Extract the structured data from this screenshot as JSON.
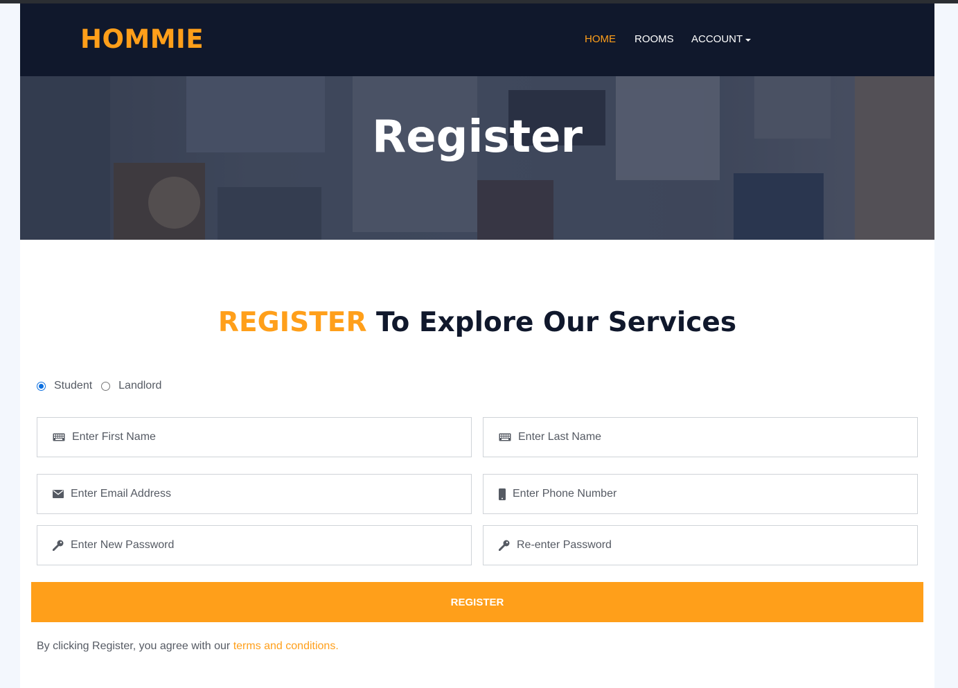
{
  "brand": {
    "name": "HOMMIE",
    "color": "#ff9f1a"
  },
  "nav": {
    "items": [
      {
        "label": "HOME",
        "active": true
      },
      {
        "label": "ROOMS",
        "active": false
      },
      {
        "label": "ACCOUNT",
        "active": false,
        "dropdown": true
      }
    ]
  },
  "hero": {
    "title": "Register"
  },
  "section": {
    "heading_highlight": "REGISTER",
    "heading_rest": " To Explore Our Services"
  },
  "user_type": {
    "options": [
      {
        "label": "Student",
        "checked": true
      },
      {
        "label": "Landlord",
        "checked": false
      }
    ]
  },
  "form": {
    "first_name": {
      "placeholder": "Enter First Name",
      "value": "",
      "icon": "keyboard-icon"
    },
    "last_name": {
      "placeholder": "Enter Last Name",
      "value": "",
      "icon": "keyboard-icon"
    },
    "email": {
      "placeholder": "Enter Email Address",
      "value": "",
      "icon": "envelope-icon"
    },
    "phone": {
      "placeholder": "Enter Phone Number",
      "value": "",
      "icon": "mobile-phone-icon"
    },
    "password": {
      "placeholder": "Enter New Password",
      "value": "",
      "icon": "key-icon"
    },
    "confirm_password": {
      "placeholder": "Re-enter Password",
      "value": "",
      "icon": "key-icon"
    },
    "submit_label": "REGISTER"
  },
  "terms": {
    "prefix": "By clicking Register, you agree with our ",
    "link": "terms and conditions."
  },
  "colors": {
    "navbar": "#10182c",
    "accent": "#ff9f1a",
    "text": "#555a63"
  }
}
